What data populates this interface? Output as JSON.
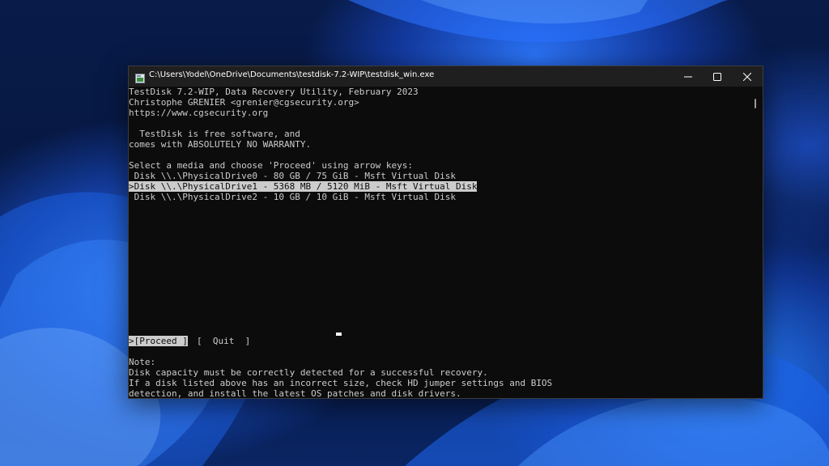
{
  "window": {
    "title": "C:\\Users\\Yodel\\OneDrive\\Documents\\testdisk-7.2-WIP\\testdisk_win.exe",
    "icon": "testdisk-app-icon",
    "controls": [
      "minimize-icon",
      "maximize-icon",
      "close-icon"
    ]
  },
  "console": {
    "header": [
      "TestDisk 7.2-WIP, Data Recovery Utility, February 2023",
      "Christophe GRENIER <grenier@cgsecurity.org>",
      "https://www.cgsecurity.org"
    ],
    "license": [
      "  TestDisk is free software, and",
      "comes with ABSOLUTELY NO WARRANTY."
    ],
    "prompt": "Select a media and choose 'Proceed' using arrow keys:",
    "disks": [
      " Disk \\\\.\\PhysicalDrive0 - 80 GB / 75 GiB - Msft Virtual Disk",
      ">Disk \\\\.\\PhysicalDrive1 - 5368 MB / 5120 MiB - Msft Virtual Disk",
      " Disk \\\\.\\PhysicalDrive2 - 10 GB / 10 GiB - Msft Virtual Disk"
    ],
    "selected_disk_index": 1,
    "actions": {
      "proceed": ">[Proceed ]",
      "quit": "[  Quit  ]"
    },
    "note": [
      "Note:",
      "Disk capacity must be correctly detected for a successful recovery.",
      "If a disk listed above has an incorrect size, check HD jumper settings and BIOS",
      "detection, and install the latest OS patches and disk drivers."
    ]
  },
  "colors": {
    "console_bg": "#0c0c0c",
    "console_fg": "#cccccc",
    "titlebar_bg": "#1f1f1f",
    "highlight_bg": "#cccccc",
    "wallpaper_accent": "#2f7bff"
  }
}
